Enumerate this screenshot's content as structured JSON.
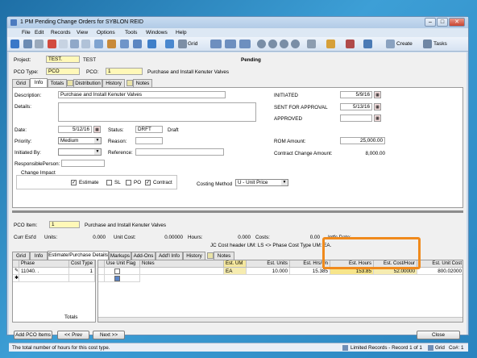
{
  "window": {
    "title": "1 PM Pending Change Orders for SYBLON REID",
    "min": "–",
    "max": "□",
    "close": "✕"
  },
  "menu": [
    "File",
    "Edit",
    "Records",
    "View",
    "Options",
    "Tools",
    "Windows",
    "Help"
  ],
  "toolbar": {
    "grid_label": "Grid",
    "create_label": "Create",
    "tasks_label": "Tasks"
  },
  "header": {
    "project_label": "Project:",
    "project_code": "TEST.",
    "project_name": "TEST",
    "status": "Pending",
    "pco_type_label": "PCO Type:",
    "pco_type": "PCO",
    "pco_label": "PCO:",
    "pco_number": "1",
    "pco_desc": "Purchase and Install Kenuter Valves"
  },
  "top_tabs": [
    "Grid",
    "Info",
    "Totals",
    "Distribution",
    "History",
    "Notes"
  ],
  "info": {
    "description_label": "Description:",
    "description": "Purchase and Install Kenuter Valves",
    "details_label": "Details:",
    "date_label": "Date:",
    "date": "5/12/16",
    "status_label": "Status:",
    "status_code": "DRFT",
    "status_text": "Draft",
    "priority_label": "Priority:",
    "priority": "Medium",
    "reason_label": "Reason:",
    "initiated_by_label": "Initiated By:",
    "reference_label": "Reference:",
    "responsible_label": "ResponsiblePerson:",
    "initiated_label": "INITIATED",
    "initiated_date": "5/9/16",
    "sent_label": "SENT FOR APPROVAL",
    "sent_date": "5/13/16",
    "approved_label": "APPROVED",
    "rom_label": "ROM Amount:",
    "rom_amount": "25,000.00",
    "contract_change_label": "Contract Change Amount:",
    "contract_change_amount": "8,000.00",
    "change_impact_label": "Change Impact",
    "impacts": [
      {
        "label": "Estimate",
        "checked": true
      },
      {
        "label": "SL",
        "checked": false
      },
      {
        "label": "PO",
        "checked": false
      },
      {
        "label": "Contract",
        "checked": true
      }
    ],
    "costing_method_label": "Costing Method",
    "costing_method": "U - Unit Price"
  },
  "item": {
    "pco_item_label": "PCO Item:",
    "pco_item": "1",
    "pco_item_desc": "Purchase and Install Kenuter Valves",
    "curr_estd_label": "Curr Est'd",
    "units_label": "Units:",
    "units": "0.000",
    "unit_cost_label": "Unit Cost:",
    "unit_cost": "0.00000",
    "hours_label": "Hours:",
    "hours": "0.000",
    "costs_label": "Costs:",
    "costs": "0.00",
    "intfc_label": "Intfc Date:",
    "jc_note": "JC Cost header UM: LS <> Phase Cost Type UM: EA."
  },
  "bottom_tabs": [
    "Grid",
    "Info",
    "Estimate/Purchase Details",
    "Markups",
    "Add-Ons",
    "Add'l Info",
    "History",
    "Notes"
  ],
  "left_grid": {
    "headers": [
      "Phase",
      "Cost Type"
    ],
    "row": {
      "phase": "11040.  .",
      "cost_type": "1"
    },
    "totals_label": "Totals"
  },
  "right_grid": {
    "headers": [
      "Use Unit Flag",
      "Notes",
      "Est. UM",
      "Est. Units",
      "Est. Hrs/Un",
      "Est. Hours",
      "Est. Cost/Hour",
      "Est. Unit Cost"
    ],
    "row": {
      "um": "EA",
      "units": "10.000",
      "hrs_un": "15.385",
      "hours": "153.85",
      "cost_hour": "52.00000",
      "unit_cost": "800.02000"
    }
  },
  "buttons": {
    "add_pco_items": "Add PCO Items",
    "prev": "<< Prev",
    "next": "Next >>",
    "close": "Close"
  },
  "status_bar": {
    "message": "The total number of hours for this cost type.",
    "records": "Limited Records - Record 1 of 1",
    "grid": "Grid",
    "co": "Co#: 1"
  }
}
